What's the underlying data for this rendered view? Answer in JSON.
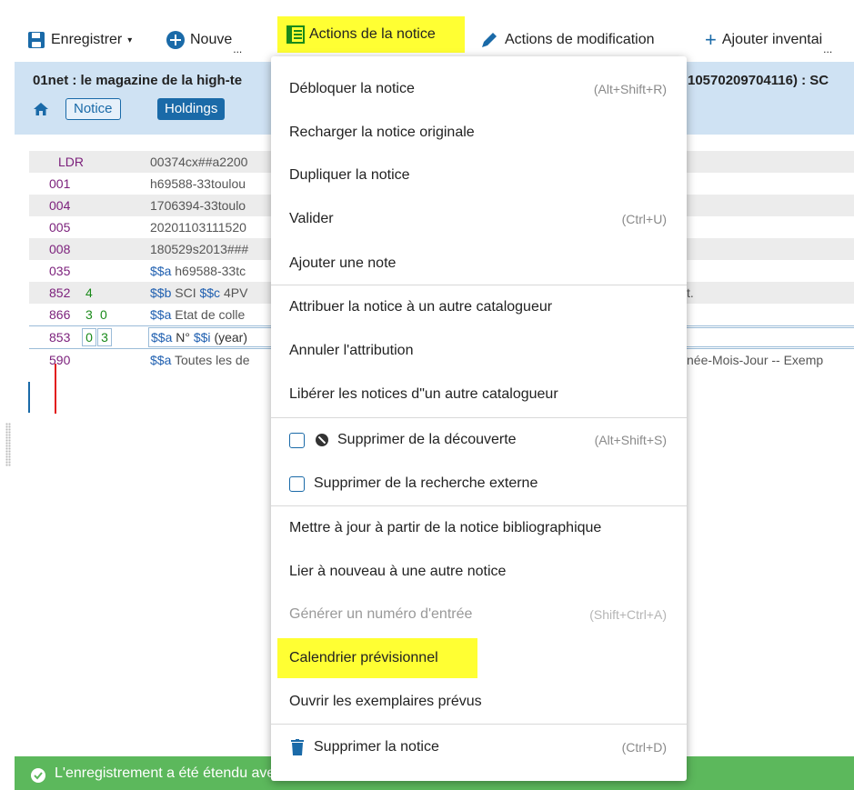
{
  "toolbar": {
    "save": "Enregistrer",
    "new": "Nouve",
    "new_more": "...",
    "record_actions": "Actions de la notice",
    "edit_actions": "Actions de modification",
    "add_inventory": "Ajouter inventai",
    "add_more": "..."
  },
  "record": {
    "title": "01net : le magazine de la high-te",
    "title_right": "10570209704116) : SC",
    "tab_notice": "Notice",
    "tab_holdings": "Holdings"
  },
  "marc_rows": [
    {
      "tag": "LDR",
      "ind1": "",
      "ind2": "",
      "content": "00374cx##a2200"
    },
    {
      "tag": "001",
      "ind1": "",
      "ind2": "",
      "content": "h69588-33toulou"
    },
    {
      "tag": "004",
      "ind1": "",
      "ind2": "",
      "content": "1706394-33toulo"
    },
    {
      "tag": "005",
      "ind1": "",
      "ind2": "",
      "content": "20201103111520"
    },
    {
      "tag": "008",
      "ind1": "",
      "ind2": "",
      "content": "180529s2013###"
    },
    {
      "tag": "035",
      "ind1": "",
      "ind2": "",
      "sub_a": "$$a",
      "content": "h69588-33tc"
    },
    {
      "tag": "852",
      "ind1": "4",
      "ind2": "",
      "sub_b": "$$b",
      "text_b": "SCI",
      "sub_c": "$$c",
      "content": "4PV",
      "tail": "t."
    },
    {
      "tag": "866",
      "ind1": "3",
      "ind2": "0",
      "sub_a": "$$a",
      "content": "Etat de colle"
    },
    {
      "tag": "853",
      "ind1": "0",
      "ind2": "3",
      "sub_a": "$$a",
      "text_a": "N°",
      "sub_i": "$$i",
      "content": "(year)"
    },
    {
      "tag": "590",
      "ind1": "",
      "ind2": "",
      "sub_a": "$$a",
      "content": "Toutes les de",
      "tail": "née-Mois-Jour -- Exemp"
    }
  ],
  "menu": {
    "unlock": {
      "label": "Débloquer la notice",
      "shortcut": "(Alt+Shift+R)"
    },
    "reload": {
      "label": "Recharger la notice originale"
    },
    "duplicate": {
      "label": "Dupliquer la notice"
    },
    "validate": {
      "label": "Valider",
      "shortcut": "(Ctrl+U)"
    },
    "add_note": {
      "label": "Ajouter une note"
    },
    "assign": {
      "label": "Attribuer la notice à un autre catalogueur"
    },
    "unassign": {
      "label": "Annuler l'attribution"
    },
    "release": {
      "label": "Libérer les notices d\"un autre catalogueur"
    },
    "suppress_discovery": {
      "label": "Supprimer de la découverte",
      "shortcut": "(Alt+Shift+S)"
    },
    "suppress_external": {
      "label": "Supprimer de la recherche externe"
    },
    "update_from_bib": {
      "label": "Mettre à jour à partir de la notice bibliographique"
    },
    "relink": {
      "label": "Lier à nouveau à une autre notice"
    },
    "generate_entry": {
      "label": "Générer un numéro d'entrée",
      "shortcut": "(Shift+Ctrl+A)"
    },
    "prediction": {
      "label": "Calendrier prévisionnel"
    },
    "open_predicted": {
      "label": "Ouvrir les exemplaires prévus"
    },
    "delete": {
      "label": "Supprimer la notice",
      "shortcut": "(Ctrl+D)"
    }
  },
  "status": {
    "success": "L'enregistrement a été étendu avec succès"
  },
  "colors": {
    "highlight": "#ffff33",
    "primary": "#1a6aa8",
    "success": "#5cb85c",
    "header_bg": "#cfe2f3"
  }
}
